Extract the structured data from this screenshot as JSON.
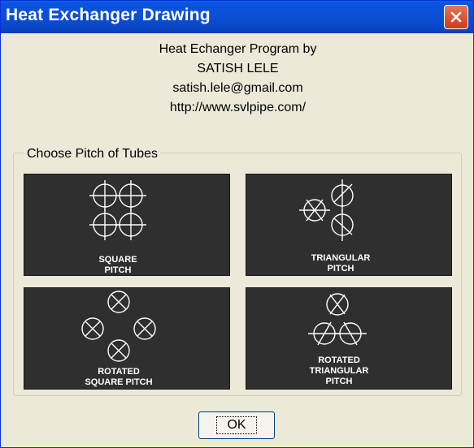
{
  "window": {
    "title": "Heat Exchanger Drawing"
  },
  "info": {
    "line1": "Heat Echanger Program by",
    "line2": "SATISH LELE",
    "line3": "satish.lele@gmail.com",
    "line4": "http://www.svlpipe.com/"
  },
  "group": {
    "label": "Choose Pitch of Tubes"
  },
  "options": {
    "square": {
      "line1": "SQUARE",
      "line2": "PITCH"
    },
    "triangular": {
      "line1": "TRIANGULAR",
      "line2": "PITCH"
    },
    "rotated_square": {
      "line1": "ROTATED",
      "line2": "SQUARE PITCH"
    },
    "rotated_triangular": {
      "line1": "ROTATED",
      "line2": "TRIANGULAR",
      "line3": "PITCH"
    }
  },
  "buttons": {
    "ok": "OK"
  },
  "icons": {
    "close": "close-icon"
  },
  "colors": {
    "titlebar": "#0a54dd",
    "tile_bg": "#2f2f2f",
    "face": "#ece9d8",
    "close": "#d1391c"
  }
}
